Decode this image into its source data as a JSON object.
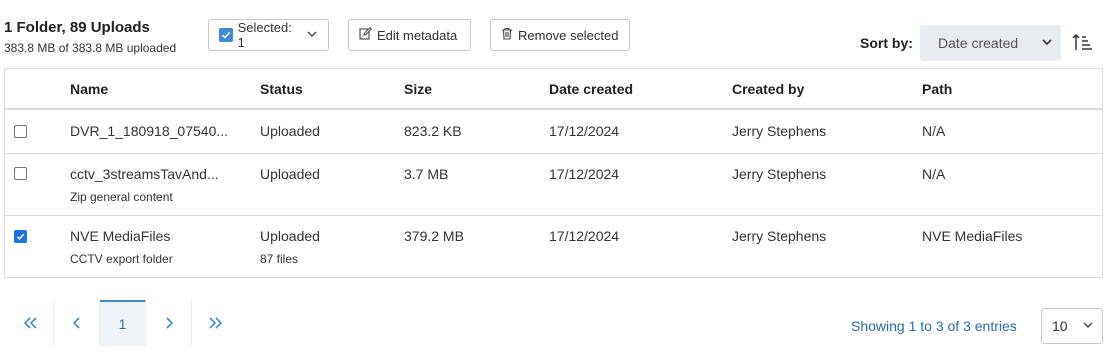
{
  "summary": {
    "title": "1 Folder, 89 Uploads",
    "subtitle": "383.8 MB of 383.8 MB uploaded"
  },
  "toolbar": {
    "selected_label": "Selected: 1",
    "edit_label": "Edit metadata",
    "remove_label": "Remove selected"
  },
  "sort": {
    "label": "Sort by:",
    "value": "Date created"
  },
  "table": {
    "columns": [
      "Name",
      "Status",
      "Size",
      "Date created",
      "Created by",
      "Path"
    ],
    "rows": [
      {
        "checked": false,
        "name": "DVR_1_180918_07540...",
        "name_sub": "",
        "status": "Uploaded",
        "status_sub": "",
        "size": "823.2 KB",
        "date": "17/12/2024",
        "created_by": "Jerry Stephens",
        "path": "N/A"
      },
      {
        "checked": false,
        "name": "cctv_3streamsTavAnd...",
        "name_sub": "Zip general content",
        "status": "Uploaded",
        "status_sub": "",
        "size": "3.7 MB",
        "date": "17/12/2024",
        "created_by": "Jerry Stephens",
        "path": "N/A"
      },
      {
        "checked": true,
        "name": "NVE MediaFiles",
        "name_sub": "CCTV export folder",
        "status": "Uploaded",
        "status_sub": "87 files",
        "size": "379.2 MB",
        "date": "17/12/2024",
        "created_by": "Jerry Stephens",
        "path": "NVE MediaFiles"
      }
    ]
  },
  "pagination": {
    "current_page": "1",
    "showing": "Showing 1 to 3 of 3 entries",
    "per_page": "10"
  },
  "colors": {
    "accent": "#3d8bd9",
    "link": "#2b6cb0",
    "checkbox_checked": "#1a73e8",
    "sort_bg": "#e9ecef"
  },
  "icons": {
    "selected": "checkbox-checked-icon",
    "dropdown": "chevron-down-icon",
    "edit": "edit-icon",
    "remove": "trash-icon",
    "sort_direction": "sort-ascending-icon",
    "first": "double-chevron-left-icon",
    "prev": "chevron-left-icon",
    "next": "chevron-right-icon",
    "last": "double-chevron-right-icon"
  }
}
